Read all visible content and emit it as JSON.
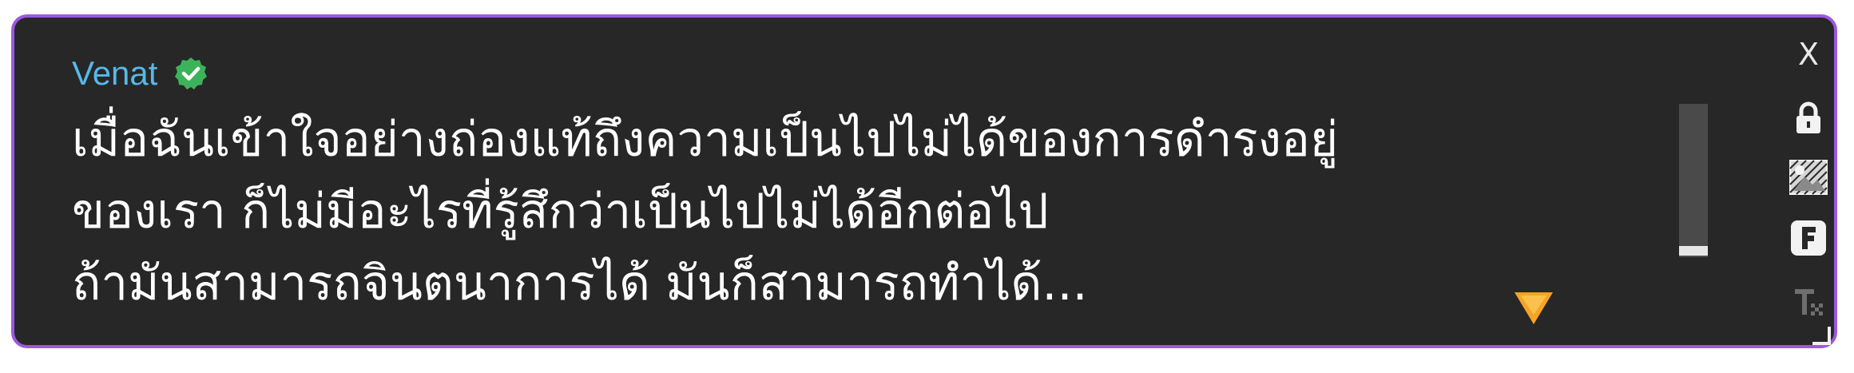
{
  "dialog": {
    "speaker": "Venat",
    "lines": [
      "เมื่อฉันเข้าใจอย่างถ่องแท้ถึงความเป็นไปไม่ได้ของการดำรงอยู่",
      "ของเรา ก็ไม่มีอะไรที่รู้สึกว่าเป็นไปไม่ได้อีกต่อไป",
      "ถ้ามันสามารถจินตนาการได้ มันก็สามารถทำได้..."
    ]
  },
  "toolbar": {
    "close_label": "X",
    "icons": [
      "close-icon",
      "lock-icon",
      "image-icon",
      "font-icon",
      "clear-format-icon",
      "resize-handle-icon"
    ]
  },
  "colors": {
    "border": "#9b59e0",
    "background": "#272727",
    "speaker": "#56b8ea",
    "verified": "#3cb35a",
    "arrow": "#f7a325"
  }
}
